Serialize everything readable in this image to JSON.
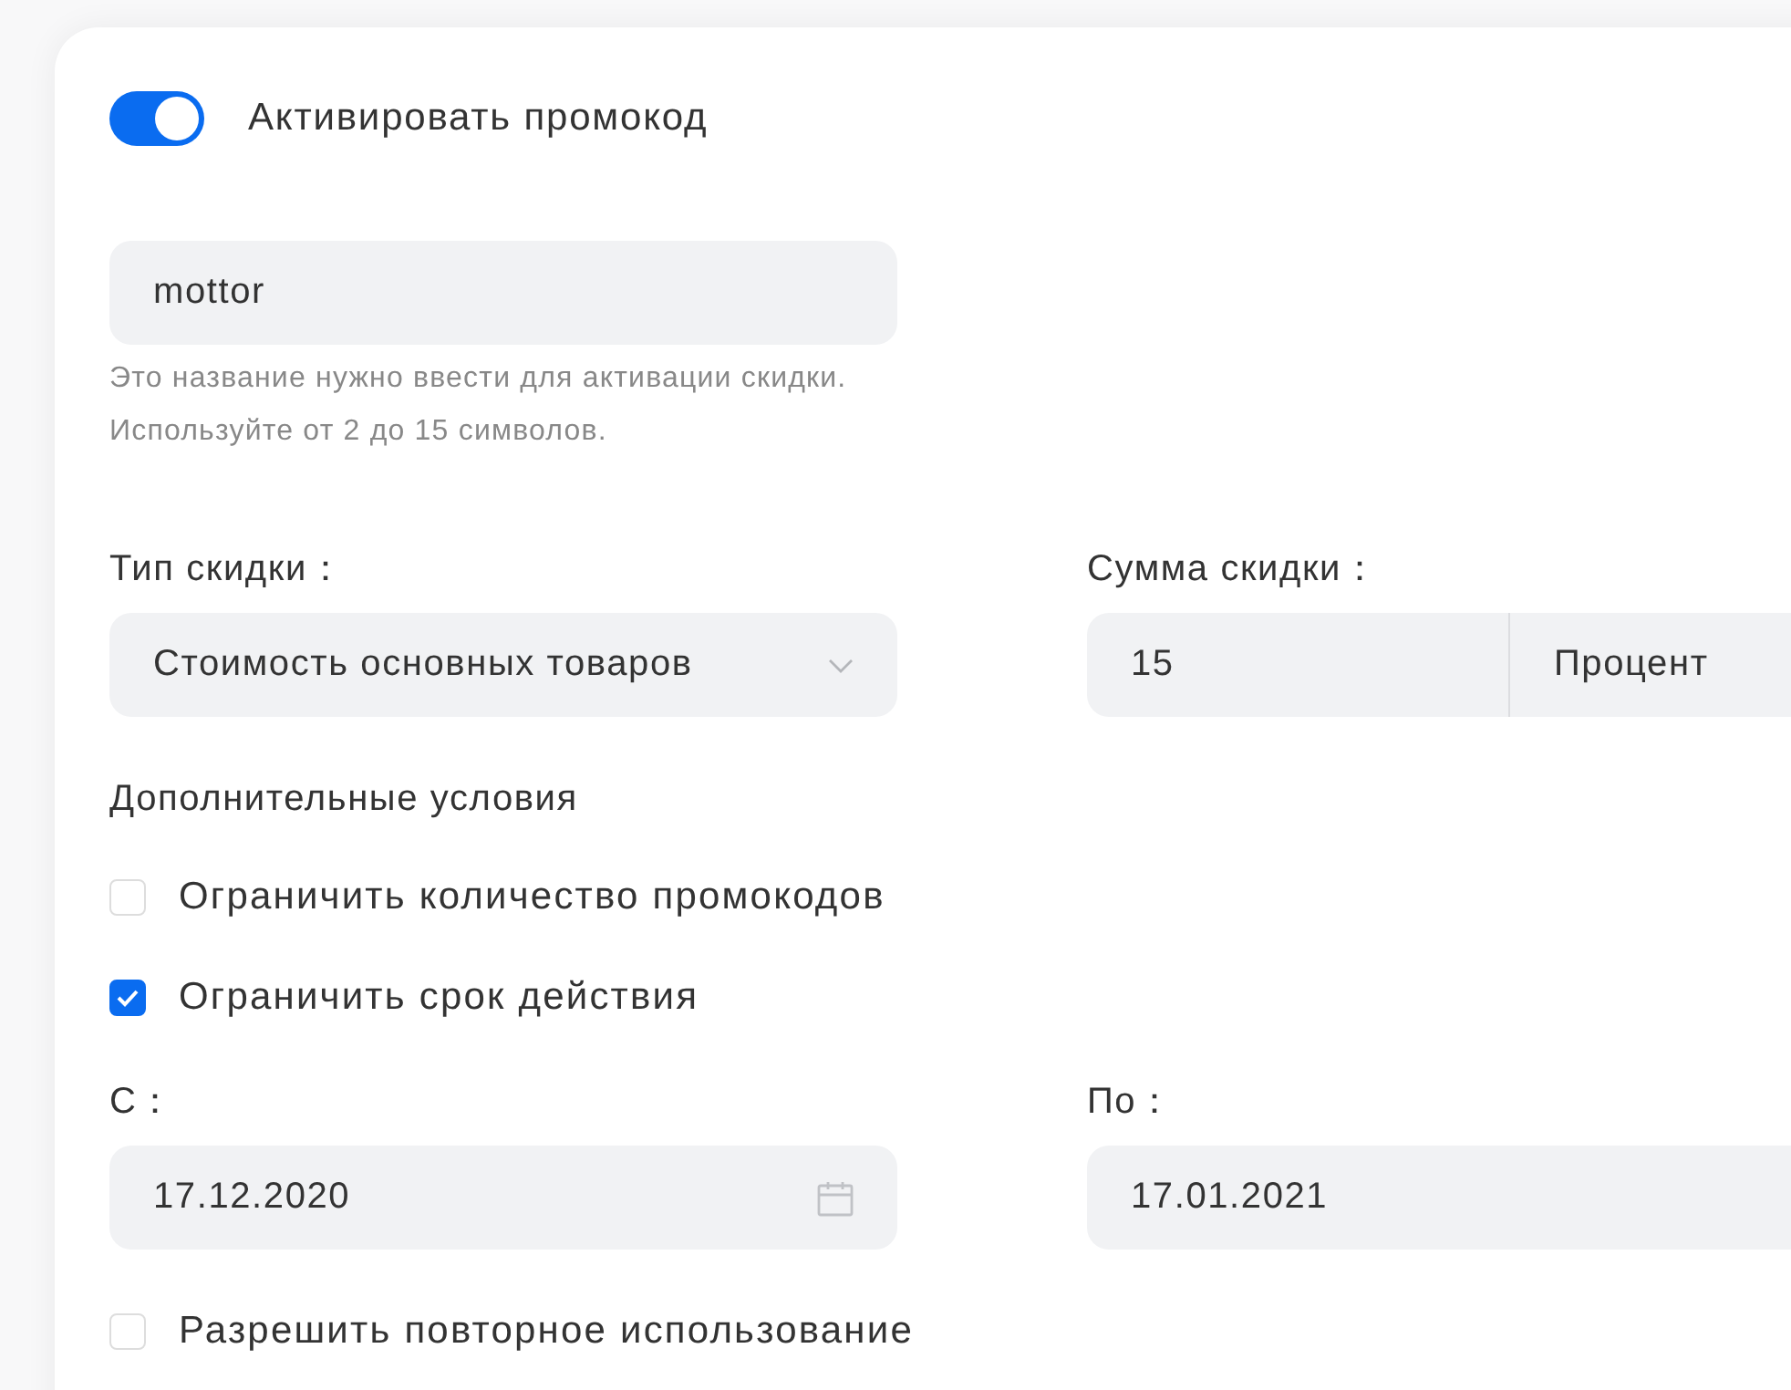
{
  "activate": {
    "label": "Активировать промокод",
    "on": true
  },
  "code": {
    "value": "mottor",
    "hint": "Это название нужно ввести для активации скидки. Используйте от 2 до 15 символов."
  },
  "discount_type": {
    "label": "Тип скидки：",
    "value": "Стоимость основных товаров"
  },
  "discount_amount": {
    "label": "Сумма скидки：",
    "value": "15",
    "unit": "Процент"
  },
  "conditions": {
    "title": "Дополнительные условия",
    "options": [
      {
        "label": "Ограничить количество промокодов",
        "checked": false
      },
      {
        "label": "Ограничить срок действия",
        "checked": true
      }
    ]
  },
  "dates": {
    "from": {
      "label": "С：",
      "value": "17.12.2020"
    },
    "to": {
      "label": "По：",
      "value": "17.01.2021"
    }
  },
  "reuse": {
    "label": "Разрешить повторное использование",
    "checked": false
  }
}
